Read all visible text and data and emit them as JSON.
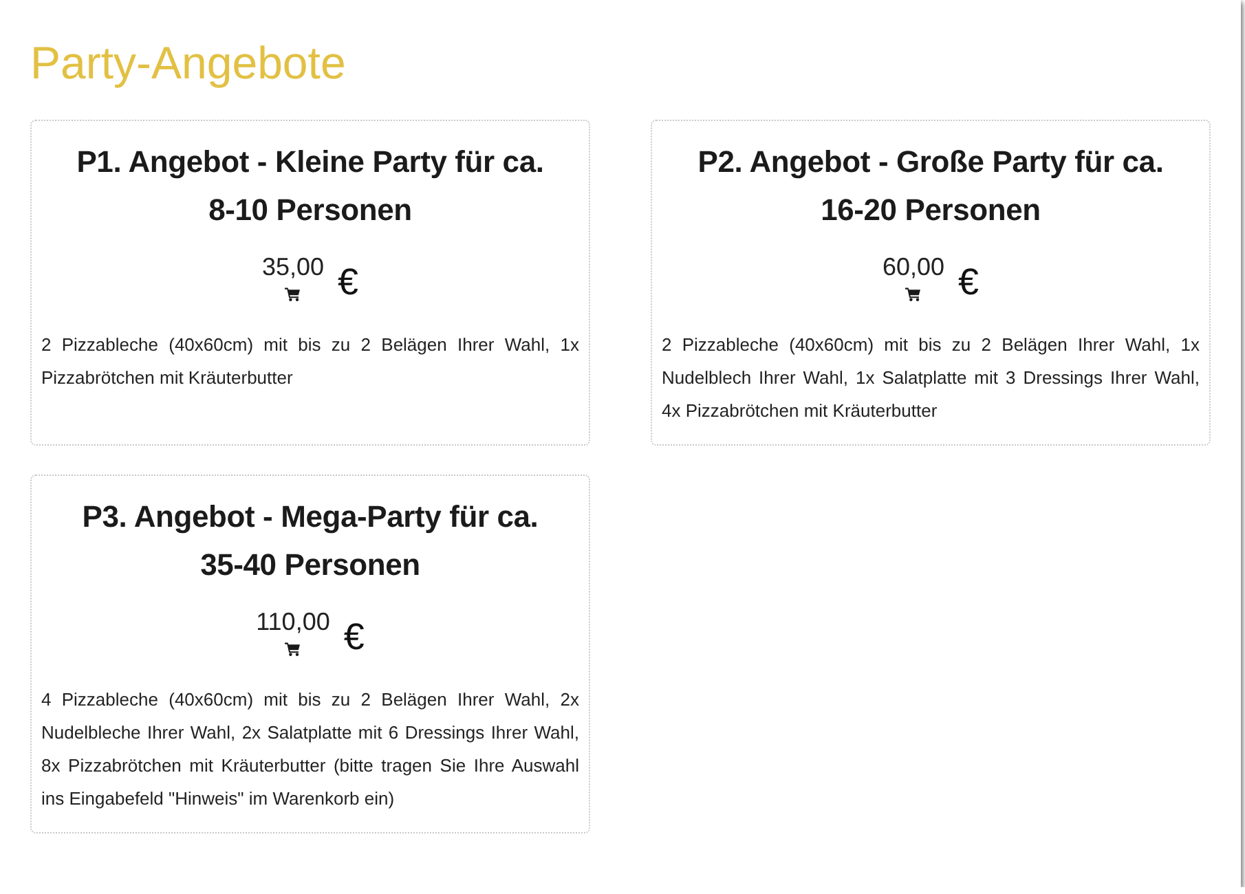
{
  "heading": "Party-Angebote",
  "offers": [
    {
      "title": "P1. Angebot - Kleine Party für ca. 8-10 Personen",
      "price": "35,00",
      "currency": "€",
      "description": "2 Pizzableche (40x60cm) mit bis zu 2 Belägen Ihrer Wahl, 1x Pizzabrötchen mit Kräuterbutter"
    },
    {
      "title": "P2. Angebot - Große Party für ca. 16-20 Personen",
      "price": "60,00",
      "currency": "€",
      "description": "2 Pizzableche (40x60cm) mit bis zu 2 Belägen Ihrer Wahl, 1x Nudelblech Ihrer Wahl, 1x Salatplatte mit 3 Dressings Ihrer Wahl, 4x Pizzabrötchen mit Kräuterbutter"
    },
    {
      "title": "P3. Angebot - Mega-Party für ca. 35-40 Personen",
      "price": "110,00",
      "currency": "€",
      "description": "4 Pizzableche (40x60cm) mit bis zu 2 Belägen Ihrer Wahl, 2x Nudelbleche Ihrer Wahl, 2x Salatplatte mit 6 Dressings Ihrer Wahl, 8x Pizzabrötchen mit Kräuterbutter (bitte tragen Sie Ihre Auswahl ins Eingabefeld \"Hinweis\" im Warenkorb ein)"
    }
  ]
}
